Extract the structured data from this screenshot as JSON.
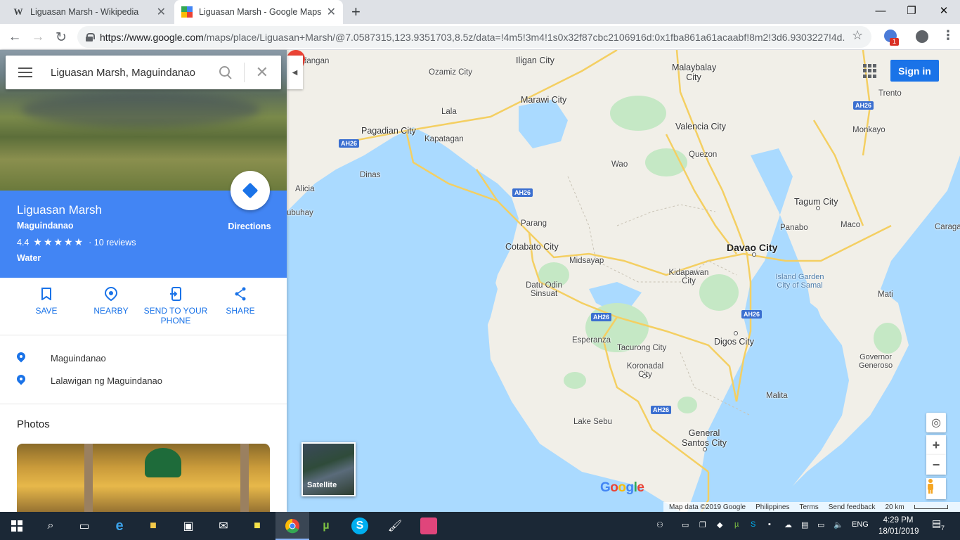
{
  "browser": {
    "tabs": [
      {
        "title": "Liguasan Marsh - Wikipedia",
        "favicon": "W"
      },
      {
        "title": "Liguasan Marsh - Google Maps",
        "favicon": "maps-icon"
      }
    ],
    "url_domain": "https://www.google.com",
    "url_path": "/maps/place/Liguasan+Marsh/@7.0587315,123.9351703,8.5z/data=!4m5!3m4!1s0x32f87cbc2106916d:0x1fba861a61acaabf!8m2!3d6.9303227!4d...",
    "extension_badge": "1"
  },
  "search": {
    "query": "Liguasan Marsh, Maguindanao"
  },
  "place": {
    "name": "Liguasan Marsh",
    "region": "Maguindanao",
    "rating": "4.4",
    "rating_value": 4.4,
    "stars": "★★★★★",
    "reviews": "· 10 reviews",
    "type": "Water",
    "directions_label": "Directions",
    "accent_color": "#4285f4"
  },
  "actions": [
    {
      "label": "SAVE",
      "icon": "bookmark-icon"
    },
    {
      "label": "NEARBY",
      "icon": "nearby-icon"
    },
    {
      "label": "SEND TO YOUR PHONE",
      "icon": "send-to-phone-icon"
    },
    {
      "label": "SHARE",
      "icon": "share-icon"
    }
  ],
  "address": [
    "Maguindanao",
    "Lalawigan ng Maguindanao"
  ],
  "photos_heading": "Photos",
  "map": {
    "signin_label": "Sign in",
    "satellite_label": "Satellite",
    "logo": "Google",
    "footer": {
      "data": "Map data ©2019 Google",
      "country": "Philippines",
      "terms": "Terms",
      "feedback": "Send feedback",
      "scale": "20 km"
    },
    "labels": {
      "dangan": "dangan",
      "iligan": "Iligan City",
      "malaybalay": "Malaybalay City",
      "ozamiz": "Ozamiz City",
      "marawi": "Marawi City",
      "trento": "Trento",
      "lala": "Lala",
      "pagadian": "Pagadian City",
      "kapatagan": "Kapatagan",
      "valencia": "Valencia City",
      "monkayo": "Monkayo",
      "quezon": "Quezon",
      "dinas": "Dinas",
      "wao": "Wao",
      "alicia": "Alicia",
      "tagum": "Tagum City",
      "buhay": "ubuhay",
      "parang": "Parang",
      "panabo": "Panabo",
      "maco": "Maco",
      "caraga": "Caraga",
      "cotabato": "Cotabato City",
      "davao": "Davao City",
      "midsayap": "Midsayap",
      "kidapawan": "Kidapawan City",
      "island_garden": "Island Garden City of Samal",
      "datu_odin": "Datu Odin Sinsuat",
      "mati": "Mati",
      "digos": "Digos City",
      "esperanza": "Esperanza",
      "tacurong": "Tacurong City",
      "koronadal": "Koronadal City",
      "governor": "Governor Generoso",
      "malita": "Malita",
      "lake_sebu": "Lake Sebu",
      "gensan": "General Santos City"
    },
    "highway": "AH26"
  },
  "taskbar": {
    "lang": "ENG",
    "time": "4:29 PM",
    "date": "18/01/2019",
    "notifications": "7"
  }
}
